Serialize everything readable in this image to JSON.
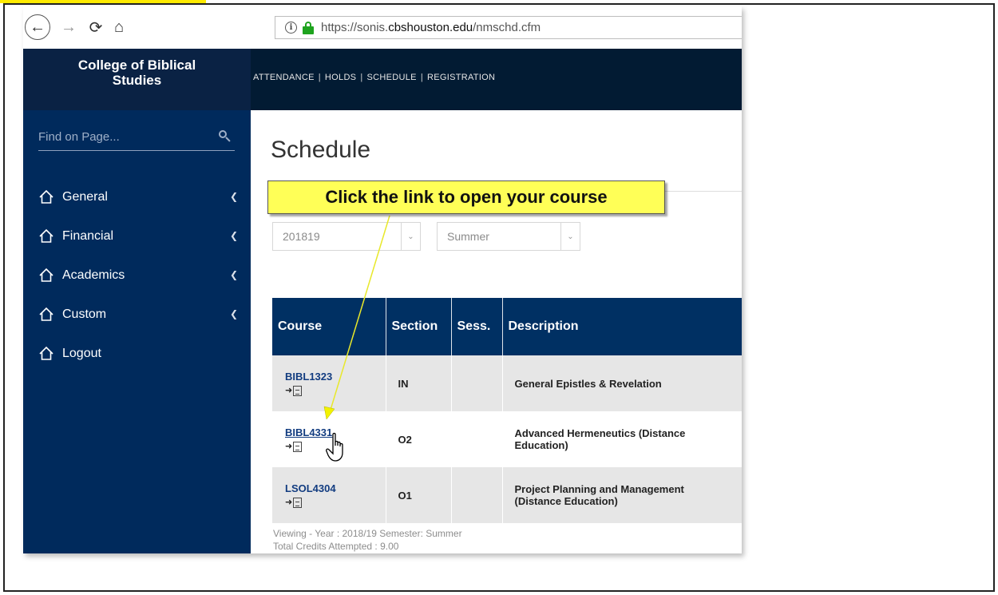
{
  "browser": {
    "back_icon": "back-arrow-icon",
    "forward_icon": "forward-arrow-icon",
    "reload_icon": "reload-icon",
    "home_icon": "home-icon",
    "url_prefix": "https://sonis.",
    "url_domain": "cbshouston.edu",
    "url_path": "/nmschd.cfm"
  },
  "header": {
    "brand": "College of Biblical Studies",
    "nav": [
      "ATTENDANCE",
      "HOLDS",
      "SCHEDULE",
      "REGISTRATION"
    ],
    "nav_separator": "|"
  },
  "sidebar": {
    "search_placeholder": "Find on Page...",
    "items": [
      {
        "label": "General",
        "has_submenu": true
      },
      {
        "label": "Financial",
        "has_submenu": true
      },
      {
        "label": "Academics",
        "has_submenu": true
      },
      {
        "label": "Custom",
        "has_submenu": true
      },
      {
        "label": "Logout",
        "has_submenu": false
      }
    ]
  },
  "main": {
    "title": "Schedule",
    "year_select": "201819",
    "semester_select": "Summer",
    "table": {
      "headers": [
        "Course",
        "Section",
        "Sess.",
        "Description"
      ],
      "rows": [
        {
          "course": "BIBL1323",
          "section": "IN",
          "sess": "",
          "description": "General Epistles & Revelation"
        },
        {
          "course": "BIBL4331",
          "section": "O2",
          "sess": "",
          "description": "Advanced Hermeneutics (Distance Education)"
        },
        {
          "course": "LSOL4304",
          "section": "O1",
          "sess": "",
          "description": "Project Planning and Management (Distance Education)"
        }
      ]
    },
    "footer_line1": "Viewing - Year : 2018/19 Semester: Summer",
    "footer_line2": "Total Credits Attempted : 9.00"
  },
  "annotation": {
    "callout": "Click the link to open your course"
  },
  "colors": {
    "header_bg": "#021b33",
    "sidebar_bg": "#002a5c",
    "table_header_bg": "#003063",
    "callout_bg": "#ffff57",
    "link": "#123c80"
  }
}
